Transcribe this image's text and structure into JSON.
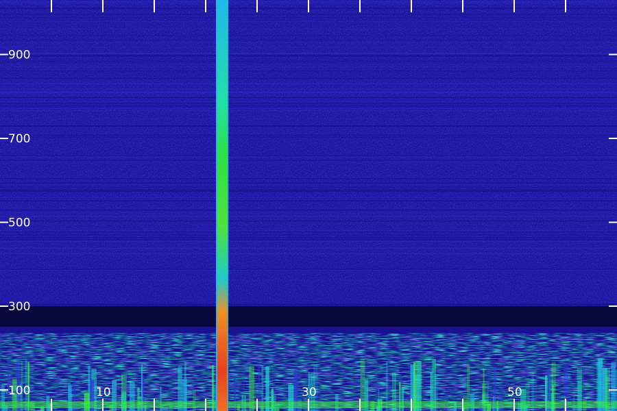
{
  "chart_data": {
    "type": "heatmap",
    "title": "",
    "xlabel": "",
    "ylabel": "",
    "x_tick_labels": [
      "10",
      "30",
      "50"
    ],
    "x_tick_values": [
      10,
      30,
      50
    ],
    "y_tick_labels": [
      "100",
      "300",
      "500",
      "700",
      "900"
    ],
    "y_tick_values": [
      100,
      300,
      500,
      700,
      900
    ],
    "xlim": [
      0,
      60
    ],
    "ylim": [
      50,
      1030
    ],
    "colormap": [
      "#0b0a4a",
      "#1a12a8",
      "#2d3ad6",
      "#1fb3e6",
      "#1fe0a0",
      "#3cf03c",
      "#c8f028",
      "#f0a020",
      "#e84020"
    ],
    "background_color": "#0d0b6e",
    "features": {
      "strong_tone": {
        "x_start": 21.0,
        "x_end": 22.2,
        "y_min": 50,
        "y_max": 1030
      },
      "cutoff_y": 300,
      "lowband_energy": {
        "y_min": 50,
        "y_max": 300
      }
    }
  }
}
